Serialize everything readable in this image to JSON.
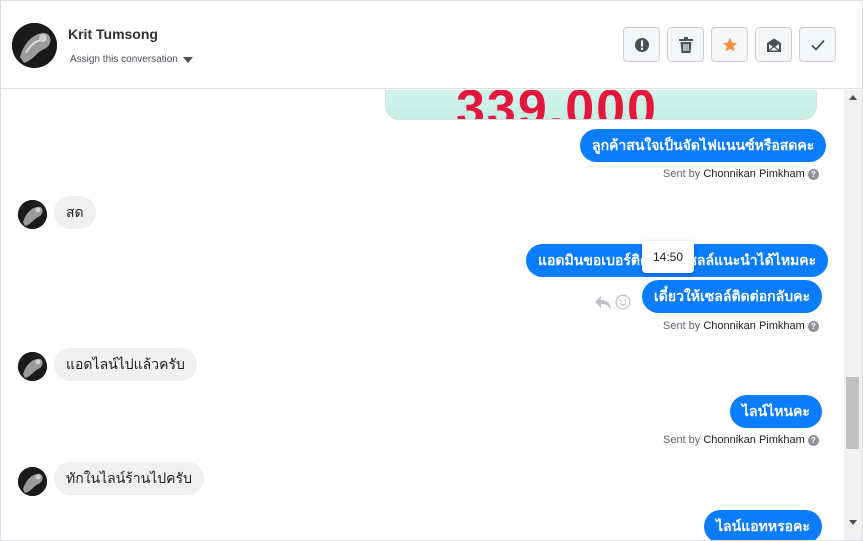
{
  "header": {
    "contact_name": "Krit Tumsong",
    "assign_label": "Assign this conversation"
  },
  "actions": [
    {
      "name": "alert",
      "icon": "exclamation-circle-icon"
    },
    {
      "name": "delete",
      "icon": "trash-icon"
    },
    {
      "name": "star",
      "icon": "star-icon",
      "color": "#f7923b"
    },
    {
      "name": "move",
      "icon": "inbox-move-icon"
    },
    {
      "name": "done",
      "icon": "check-icon"
    }
  ],
  "messages": {
    "image_text": "339,000",
    "out_1": "ลูกค้าสนใจเป็นจัดไฟแนนซ์หรือสดคะ",
    "sent_1_prefix": "Sent by",
    "sent_1_name": "Chonnikan Pimkham",
    "in_1": "สด",
    "out_2": "แอดมินขอเบอร์ติดต่อให้เซลล์แนะนำได้ไหมคะ",
    "out_3": "เดี๋ยวให้เซลล์ติดต่อกลับคะ",
    "tooltip_time": "14:50",
    "sent_2_prefix": "Sent by",
    "sent_2_name": "Chonnikan Pimkham",
    "in_2": "แอดไลน์ไปแล้วครับ",
    "out_4": "ไลน์ไหนคะ",
    "sent_3_prefix": "Sent by",
    "sent_3_name": "Chonnikan Pimkham",
    "in_3": "ทักในไลน์ร้านไปครับ",
    "out_5": "ไลน์แอทหรอคะ"
  },
  "colors": {
    "outgoing_bubble": "#0a7cff",
    "incoming_bubble": "#f0f0f0",
    "star": "#f7923b"
  }
}
